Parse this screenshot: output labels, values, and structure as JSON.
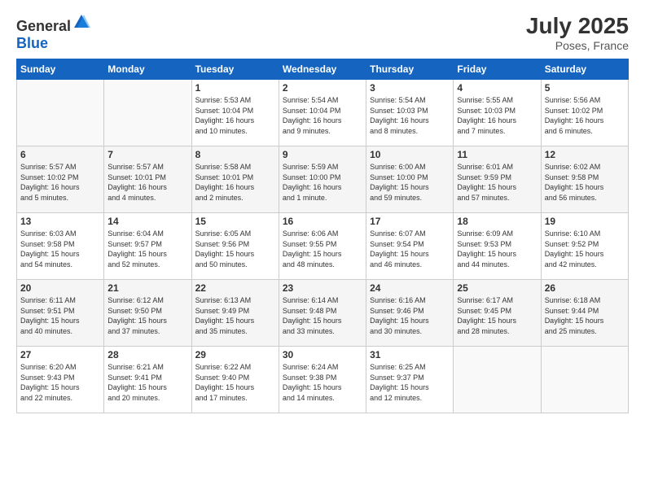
{
  "header": {
    "logo_general": "General",
    "logo_blue": "Blue",
    "title": "July 2025",
    "location": "Poses, France"
  },
  "weekdays": [
    "Sunday",
    "Monday",
    "Tuesday",
    "Wednesday",
    "Thursday",
    "Friday",
    "Saturday"
  ],
  "weeks": [
    [
      {
        "day": "",
        "info": ""
      },
      {
        "day": "",
        "info": ""
      },
      {
        "day": "1",
        "info": "Sunrise: 5:53 AM\nSunset: 10:04 PM\nDaylight: 16 hours\nand 10 minutes."
      },
      {
        "day": "2",
        "info": "Sunrise: 5:54 AM\nSunset: 10:04 PM\nDaylight: 16 hours\nand 9 minutes."
      },
      {
        "day": "3",
        "info": "Sunrise: 5:54 AM\nSunset: 10:03 PM\nDaylight: 16 hours\nand 8 minutes."
      },
      {
        "day": "4",
        "info": "Sunrise: 5:55 AM\nSunset: 10:03 PM\nDaylight: 16 hours\nand 7 minutes."
      },
      {
        "day": "5",
        "info": "Sunrise: 5:56 AM\nSunset: 10:02 PM\nDaylight: 16 hours\nand 6 minutes."
      }
    ],
    [
      {
        "day": "6",
        "info": "Sunrise: 5:57 AM\nSunset: 10:02 PM\nDaylight: 16 hours\nand 5 minutes."
      },
      {
        "day": "7",
        "info": "Sunrise: 5:57 AM\nSunset: 10:01 PM\nDaylight: 16 hours\nand 4 minutes."
      },
      {
        "day": "8",
        "info": "Sunrise: 5:58 AM\nSunset: 10:01 PM\nDaylight: 16 hours\nand 2 minutes."
      },
      {
        "day": "9",
        "info": "Sunrise: 5:59 AM\nSunset: 10:00 PM\nDaylight: 16 hours\nand 1 minute."
      },
      {
        "day": "10",
        "info": "Sunrise: 6:00 AM\nSunset: 10:00 PM\nDaylight: 15 hours\nand 59 minutes."
      },
      {
        "day": "11",
        "info": "Sunrise: 6:01 AM\nSunset: 9:59 PM\nDaylight: 15 hours\nand 57 minutes."
      },
      {
        "day": "12",
        "info": "Sunrise: 6:02 AM\nSunset: 9:58 PM\nDaylight: 15 hours\nand 56 minutes."
      }
    ],
    [
      {
        "day": "13",
        "info": "Sunrise: 6:03 AM\nSunset: 9:58 PM\nDaylight: 15 hours\nand 54 minutes."
      },
      {
        "day": "14",
        "info": "Sunrise: 6:04 AM\nSunset: 9:57 PM\nDaylight: 15 hours\nand 52 minutes."
      },
      {
        "day": "15",
        "info": "Sunrise: 6:05 AM\nSunset: 9:56 PM\nDaylight: 15 hours\nand 50 minutes."
      },
      {
        "day": "16",
        "info": "Sunrise: 6:06 AM\nSunset: 9:55 PM\nDaylight: 15 hours\nand 48 minutes."
      },
      {
        "day": "17",
        "info": "Sunrise: 6:07 AM\nSunset: 9:54 PM\nDaylight: 15 hours\nand 46 minutes."
      },
      {
        "day": "18",
        "info": "Sunrise: 6:09 AM\nSunset: 9:53 PM\nDaylight: 15 hours\nand 44 minutes."
      },
      {
        "day": "19",
        "info": "Sunrise: 6:10 AM\nSunset: 9:52 PM\nDaylight: 15 hours\nand 42 minutes."
      }
    ],
    [
      {
        "day": "20",
        "info": "Sunrise: 6:11 AM\nSunset: 9:51 PM\nDaylight: 15 hours\nand 40 minutes."
      },
      {
        "day": "21",
        "info": "Sunrise: 6:12 AM\nSunset: 9:50 PM\nDaylight: 15 hours\nand 37 minutes."
      },
      {
        "day": "22",
        "info": "Sunrise: 6:13 AM\nSunset: 9:49 PM\nDaylight: 15 hours\nand 35 minutes."
      },
      {
        "day": "23",
        "info": "Sunrise: 6:14 AM\nSunset: 9:48 PM\nDaylight: 15 hours\nand 33 minutes."
      },
      {
        "day": "24",
        "info": "Sunrise: 6:16 AM\nSunset: 9:46 PM\nDaylight: 15 hours\nand 30 minutes."
      },
      {
        "day": "25",
        "info": "Sunrise: 6:17 AM\nSunset: 9:45 PM\nDaylight: 15 hours\nand 28 minutes."
      },
      {
        "day": "26",
        "info": "Sunrise: 6:18 AM\nSunset: 9:44 PM\nDaylight: 15 hours\nand 25 minutes."
      }
    ],
    [
      {
        "day": "27",
        "info": "Sunrise: 6:20 AM\nSunset: 9:43 PM\nDaylight: 15 hours\nand 22 minutes."
      },
      {
        "day": "28",
        "info": "Sunrise: 6:21 AM\nSunset: 9:41 PM\nDaylight: 15 hours\nand 20 minutes."
      },
      {
        "day": "29",
        "info": "Sunrise: 6:22 AM\nSunset: 9:40 PM\nDaylight: 15 hours\nand 17 minutes."
      },
      {
        "day": "30",
        "info": "Sunrise: 6:24 AM\nSunset: 9:38 PM\nDaylight: 15 hours\nand 14 minutes."
      },
      {
        "day": "31",
        "info": "Sunrise: 6:25 AM\nSunset: 9:37 PM\nDaylight: 15 hours\nand 12 minutes."
      },
      {
        "day": "",
        "info": ""
      },
      {
        "day": "",
        "info": ""
      }
    ]
  ]
}
